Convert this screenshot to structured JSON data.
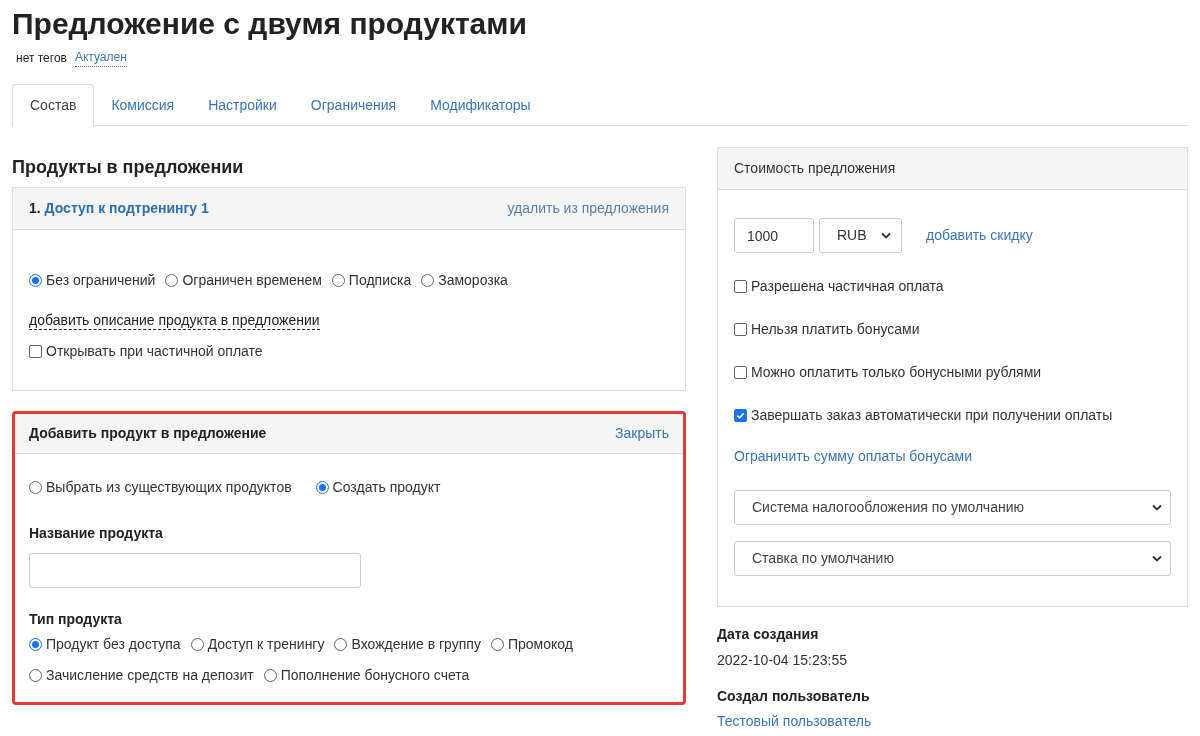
{
  "title": "Предложение с двумя продуктами",
  "tags_label": "нет тегов",
  "status_link": "Актуален",
  "tabs": [
    {
      "label": "Состав",
      "selected": true
    },
    {
      "label": "Комиссия",
      "selected": false
    },
    {
      "label": "Настройки",
      "selected": false
    },
    {
      "label": "Ограничения",
      "selected": false
    },
    {
      "label": "Модификаторы",
      "selected": false
    }
  ],
  "products_section": {
    "heading": "Продукты в предложении",
    "items": [
      {
        "number": "1.",
        "name": "Доступ к подтренингу 1",
        "remove_link": "удалить из предложения",
        "access_options": [
          {
            "label": "Без ограничений",
            "selected": true
          },
          {
            "label": "Ограничен временем",
            "selected": false
          },
          {
            "label": "Подписка",
            "selected": false
          },
          {
            "label": "Заморозка",
            "selected": false
          }
        ],
        "description_link": "добавить описание продукта в предложении",
        "open_on_partial": {
          "label": "Открывать при частичной оплате",
          "checked": false
        }
      }
    ]
  },
  "add_product": {
    "title": "Добавить продукт в предложение",
    "close_link": "Закрыть",
    "highlighted": true,
    "source_options": [
      {
        "label": "Выбрать из существующих продуктов",
        "selected": false
      },
      {
        "label": "Создать продукт",
        "selected": true
      }
    ],
    "name_label": "Название продукта",
    "type_label": "Тип продукта",
    "type_options": [
      {
        "label": "Продукт без доступа",
        "selected": true
      },
      {
        "label": "Доступ к тренингу",
        "selected": false
      },
      {
        "label": "Вхождение в группу",
        "selected": false
      },
      {
        "label": "Промокод",
        "selected": false
      },
      {
        "label": "Зачисление средств на депозит",
        "selected": false
      },
      {
        "label": "Пополнение бонусного счета",
        "selected": false
      }
    ]
  },
  "price": {
    "title": "Стоимость предложения",
    "amount": "1000",
    "currency": "RUB",
    "discount_link": "добавить скидку",
    "options": [
      {
        "label": "Разрешена частичная оплата",
        "checked": false
      },
      {
        "label": "Нельзя платить бонусами",
        "checked": false
      },
      {
        "label": "Можно оплатить только бонусными рублями",
        "checked": false
      },
      {
        "label": "Завершать заказ автоматически при получении оплаты",
        "checked": true
      }
    ],
    "limit_link": "Ограничить сумму оплаты бонусами",
    "selects": [
      "Система налогообложения по умолчанию",
      "Ставка по умолчанию"
    ]
  },
  "created": {
    "label": "Дата создания",
    "value": "2022-10-04 15:23:55"
  },
  "author": {
    "label": "Создал пользователь",
    "value": "Тестовый пользователь"
  }
}
